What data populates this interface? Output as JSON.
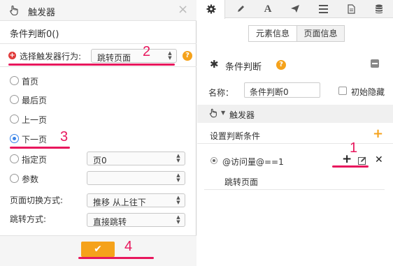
{
  "dialog": {
    "title": "触发器",
    "close_glyph": "×",
    "subtitle": "条件判断0()",
    "action_label": "选择触发器行为:",
    "action_value": "跳转页面",
    "help_glyph": "?",
    "radio_options": [
      {
        "label": "首页",
        "checked": false
      },
      {
        "label": "最后页",
        "checked": false
      },
      {
        "label": "上一页",
        "checked": false
      },
      {
        "label": "下一页",
        "checked": true
      },
      {
        "label": "指定页",
        "checked": false
      },
      {
        "label": "参数",
        "checked": false
      }
    ],
    "page_select_value": "页0",
    "param_select_value": "",
    "transition_label": "页面切换方式:",
    "transition_value": "推移 从上往下",
    "jump_label": "跳转方式:",
    "jump_value": "直接跳转",
    "ok_glyph": "✔"
  },
  "annotations": [
    "1",
    "2",
    "3",
    "4"
  ],
  "panel": {
    "toolbar_icons": [
      "gear-icon",
      "pencil-icon",
      "font-icon",
      "send-icon",
      "list-icon",
      "document-icon",
      "database-icon"
    ],
    "tab_element_info": "元素信息",
    "tab_page_info": "页面信息",
    "section_title": "条件判断",
    "name_label": "名称：",
    "name_value": "条件判断0",
    "initially_hidden_label": "初始隐藏",
    "trigger_label": "触发器",
    "set_condition_label": "设置判断条件",
    "condition_expr": "@访问量@==1",
    "condition_action": "跳转页面",
    "add_glyph": "+",
    "remove_glyph": "✕"
  },
  "colors": {
    "accent_orange": "#f5a21b",
    "annotation_pink": "#e8175d",
    "radio_blue": "#3a84e8",
    "plus_red": "#e03a3a"
  }
}
